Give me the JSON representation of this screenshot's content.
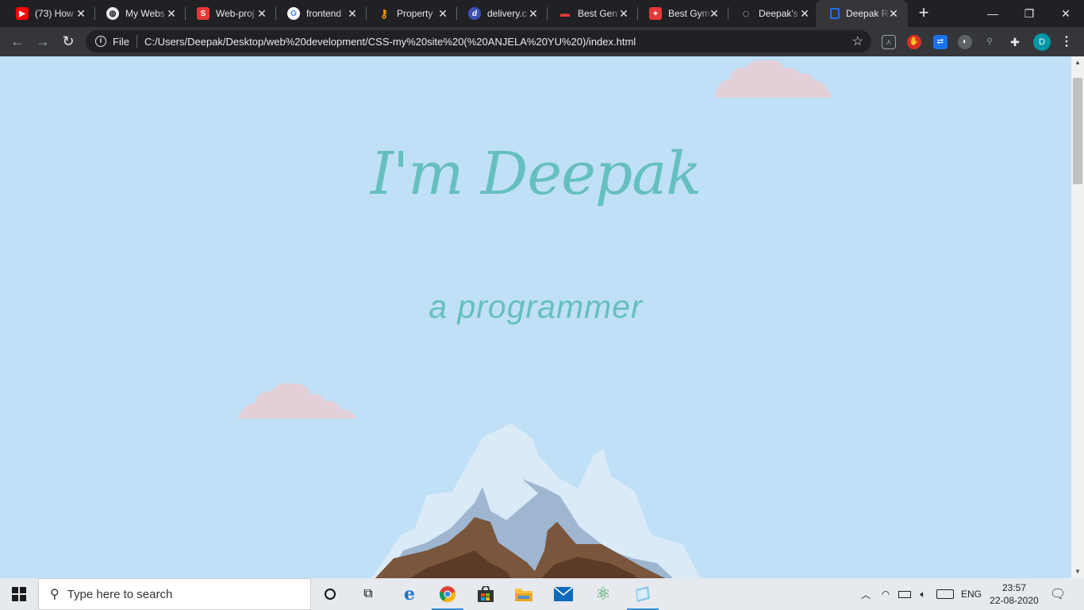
{
  "browser": {
    "tabs": [
      {
        "title": "(73) How",
        "favicon": "youtube-icon",
        "color": "#ff0000",
        "glyph": "▶"
      },
      {
        "title": "My Webs",
        "favicon": "globe-icon",
        "color": "#e8eaed",
        "glyph": "🌐"
      },
      {
        "title": "Web-proj",
        "favicon": "web-project-icon",
        "color": "#e53935",
        "glyph": "S"
      },
      {
        "title": "frontend",
        "favicon": "google-icon",
        "color": "#ffffff",
        "glyph": "G"
      },
      {
        "title": "Property",
        "favicon": "key-icon",
        "color": "#f29900",
        "glyph": "⚷"
      },
      {
        "title": "delivery.c",
        "favicon": "delivery-icon",
        "color": "#3f51b5",
        "glyph": "d"
      },
      {
        "title": "Best Gen",
        "favicon": "car-icon",
        "color": "#e53935",
        "glyph": "▬"
      },
      {
        "title": "Best Gym",
        "favicon": "gym-icon",
        "color": "#e53935",
        "glyph": "✦"
      },
      {
        "title": "Deepak's",
        "favicon": "loading-icon",
        "color": "#e8eaed",
        "glyph": "◌"
      },
      {
        "title": "Deepak R",
        "favicon": "page-icon",
        "color": "#1a73e8",
        "glyph": "▯"
      }
    ],
    "active_tab_index": 9,
    "new_tab_label": "+",
    "window_controls": {
      "minimize": "—",
      "restore": "❐",
      "close": "✕"
    },
    "address": {
      "scheme_label": "File",
      "url": "C:/Users/Deepak/Desktop/web%20development/CSS-my%20site%20(%20ANJELA%20YU%20)/index.html"
    },
    "profile_initial": "D"
  },
  "page": {
    "heading": "I'm Deepak",
    "subheading": "a programmer",
    "colors": {
      "background": "#bfe0f7",
      "text": "#66bfbf",
      "cloud": "#e2cfd8"
    }
  },
  "taskbar": {
    "search_placeholder": "Type here to search",
    "language": "ENG",
    "time": "23:57",
    "date": "22-08-2020"
  }
}
